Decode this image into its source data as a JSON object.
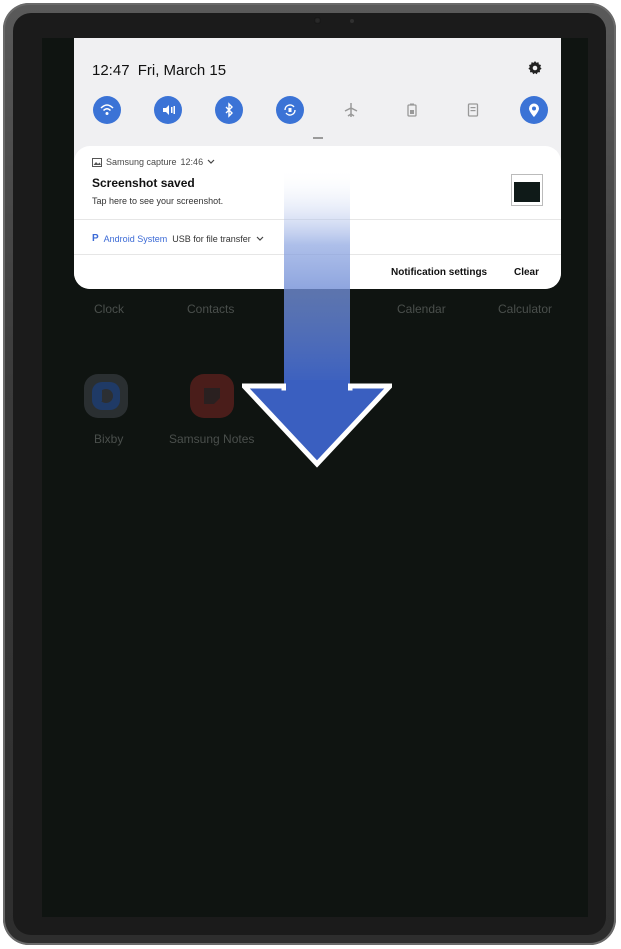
{
  "status": {
    "time": "12:47",
    "date": "Fri, March 15"
  },
  "quick_settings": [
    {
      "name": "wifi",
      "state": "on"
    },
    {
      "name": "sound",
      "state": "on"
    },
    {
      "name": "bluetooth",
      "state": "on"
    },
    {
      "name": "auto-rotate",
      "state": "on"
    },
    {
      "name": "airplane-mode",
      "state": "off"
    },
    {
      "name": "power-saving",
      "state": "off"
    },
    {
      "name": "mobile-hotspot",
      "state": "off"
    },
    {
      "name": "location",
      "state": "on"
    }
  ],
  "notification": {
    "app": "Samsung capture",
    "time": "12:46",
    "title": "Screenshot saved",
    "body": "Tap here to see your screenshot."
  },
  "system_notification": {
    "icon_letter": "P",
    "app": "Android System",
    "text": "USB for file transfer"
  },
  "actions": {
    "settings": "Notification settings",
    "clear": "Clear"
  },
  "home_apps": {
    "row1": [
      "Clock",
      "Contacts",
      "Calendar",
      "Calculator"
    ],
    "row2": [
      "Bixby",
      "Samsung Notes"
    ]
  },
  "colors": {
    "accent": "#3b73d6",
    "arrow": "#3a5fc0"
  }
}
